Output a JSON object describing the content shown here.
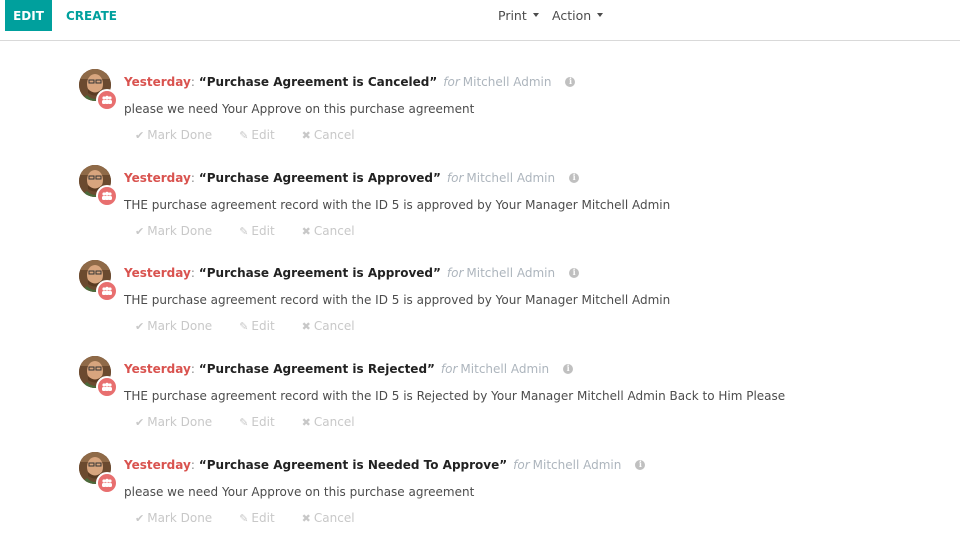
{
  "toolbar": {
    "edit_label": "EDIT",
    "create_label": "CREATE",
    "print_label": "Print",
    "action_label": "Action"
  },
  "colors": {
    "accent": "#00a09d",
    "date": "#d9534f",
    "badge": "#e86f6f",
    "muted": "#adb5bd"
  },
  "activities": [
    {
      "date": "Yesterday",
      "summary": "“Purchase Agreement is Canceled”",
      "for_label": "for",
      "user": "Mitchell Admin",
      "note": "please we need Your Approve on this purchase agreement",
      "actions": {
        "mark_done": "Mark Done",
        "edit": "Edit",
        "cancel": "Cancel"
      }
    },
    {
      "date": "Yesterday",
      "summary": "“Purchase Agreement is Approved”",
      "for_label": "for",
      "user": "Mitchell Admin",
      "note": "THE purchase agreement record with the ID 5 is approved by Your Manager Mitchell Admin",
      "actions": {
        "mark_done": "Mark Done",
        "edit": "Edit",
        "cancel": "Cancel"
      }
    },
    {
      "date": "Yesterday",
      "summary": "“Purchase Agreement is Approved”",
      "for_label": "for",
      "user": "Mitchell Admin",
      "note": "THE purchase agreement record with the ID 5 is approved by Your Manager Mitchell Admin",
      "actions": {
        "mark_done": "Mark Done",
        "edit": "Edit",
        "cancel": "Cancel"
      }
    },
    {
      "date": "Yesterday",
      "summary": "“Purchase Agreement is Rejected”",
      "for_label": "for",
      "user": "Mitchell Admin",
      "note": "THE purchase agreement record with the ID 5 is Rejected by Your Manager Mitchell Admin Back to Him Please",
      "actions": {
        "mark_done": "Mark Done",
        "edit": "Edit",
        "cancel": "Cancel"
      }
    },
    {
      "date": "Yesterday",
      "summary": "“Purchase Agreement is Needed To Approve”",
      "for_label": "for",
      "user": "Mitchell Admin",
      "note": "please we need Your Approve on this purchase agreement",
      "actions": {
        "mark_done": "Mark Done",
        "edit": "Edit",
        "cancel": "Cancel"
      }
    }
  ]
}
